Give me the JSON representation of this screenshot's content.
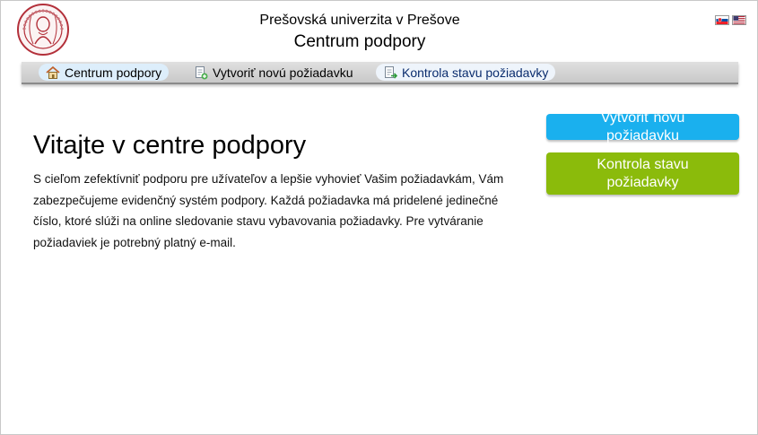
{
  "header": {
    "university": "Prešovská univerzita v Prešove",
    "center": "Centrum podpory",
    "logo_icon": "university-seal-icon",
    "languages": [
      {
        "code": "sk",
        "icon": "flag-slovakia-icon"
      },
      {
        "code": "en",
        "icon": "flag-usa-icon"
      }
    ]
  },
  "nav": {
    "items": [
      {
        "label": "Centrum podpory",
        "icon": "home-icon",
        "state": "active"
      },
      {
        "label": "Vytvoriť novú požiadavku",
        "icon": "new-ticket-icon",
        "state": "normal"
      },
      {
        "label": "Kontrola stavu požiadavky",
        "icon": "ticket-status-icon",
        "state": "highlighted"
      }
    ]
  },
  "main": {
    "title": "Vitajte v centre podpory",
    "intro": "S cieľom zefektívniť podporu pre užívateľov a lepšie vyhovieť Vašim požiadavkám, Vám zabezpečujeme evidenčný systém podpory. Každá požiadavka má pridelené jedinečné číslo, ktoré slúži na online sledovanie stavu vybavovania  požiadavky. Pre vytváranie požiadaviek je potrebný platný e-mail.",
    "buttons": {
      "new_ticket": "Vytvoriť novú požiadavku",
      "check_status": "Kontrola stavu požiadavky"
    }
  },
  "colors": {
    "new_ticket_button": "#1ab0ee",
    "check_status_button": "#8bbb0b",
    "logo": "#b3303a"
  }
}
